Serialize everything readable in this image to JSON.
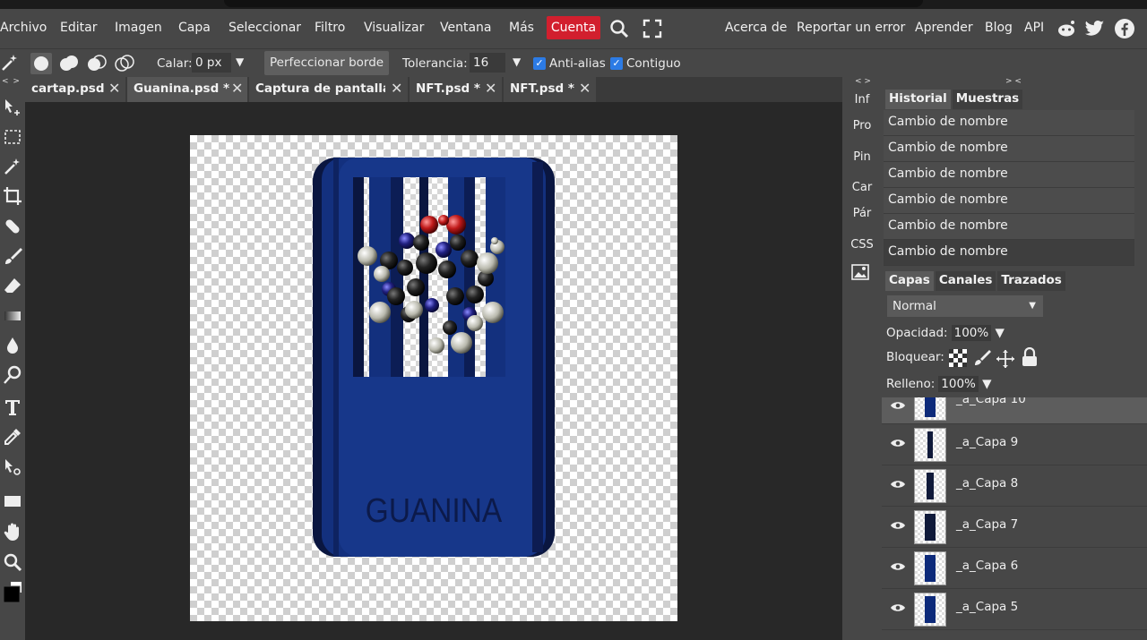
{
  "menu": {
    "items": [
      "Archivo",
      "Editar",
      "Imagen",
      "Capa",
      "Seleccionar",
      "Filtro",
      "Visualizar",
      "Ventana",
      "Más"
    ],
    "account": "Cuenta",
    "right_links": [
      "Acerca de",
      "Reportar un error",
      "Aprender",
      "Blog",
      "API"
    ]
  },
  "options": {
    "feather_label": "Calar:",
    "feather_value": "0 px",
    "refine_edge": "Perfeccionar borde",
    "tolerance_label": "Tolerancia:",
    "tolerance_value": "16",
    "antialias": "Anti-alias",
    "contiguous": "Contiguo"
  },
  "tabs": [
    {
      "label": "cartap.psd"
    },
    {
      "label": "Guanina.psd *"
    },
    {
      "label": "Captura de pantalla"
    },
    {
      "label": "NFT.psd *"
    },
    {
      "label": "NFT.psd *"
    }
  ],
  "canvas": {
    "label": "GUANINA"
  },
  "mini_panel": [
    "Inf",
    "Pro",
    "Pin",
    "Car",
    "Pár",
    "CSS"
  ],
  "history": {
    "tabs": [
      "Historial",
      "Muestras"
    ],
    "items": [
      "Cambio de nombre",
      "Cambio de nombre",
      "Cambio de nombre",
      "Cambio de nombre",
      "Cambio de nombre",
      "Cambio de nombre"
    ]
  },
  "layers_panel": {
    "tabs": [
      "Capas",
      "Canales",
      "Trazados"
    ],
    "blend_mode": "Normal",
    "opacity_label": "Opacidad:",
    "opacity_value": "100%",
    "lock_label": "Bloquear:",
    "fill_label": "Relleno:",
    "fill_value": "100%",
    "layers": [
      "_a_Capa 10",
      "_a_Capa 9",
      "_a_Capa 8",
      "_a_Capa 7",
      "_a_Capa 6",
      "_a_Capa 5"
    ]
  },
  "colors": {
    "account_bg": "#d21f2e",
    "panel_bg": "#474747",
    "card_blue": "#17378a"
  }
}
